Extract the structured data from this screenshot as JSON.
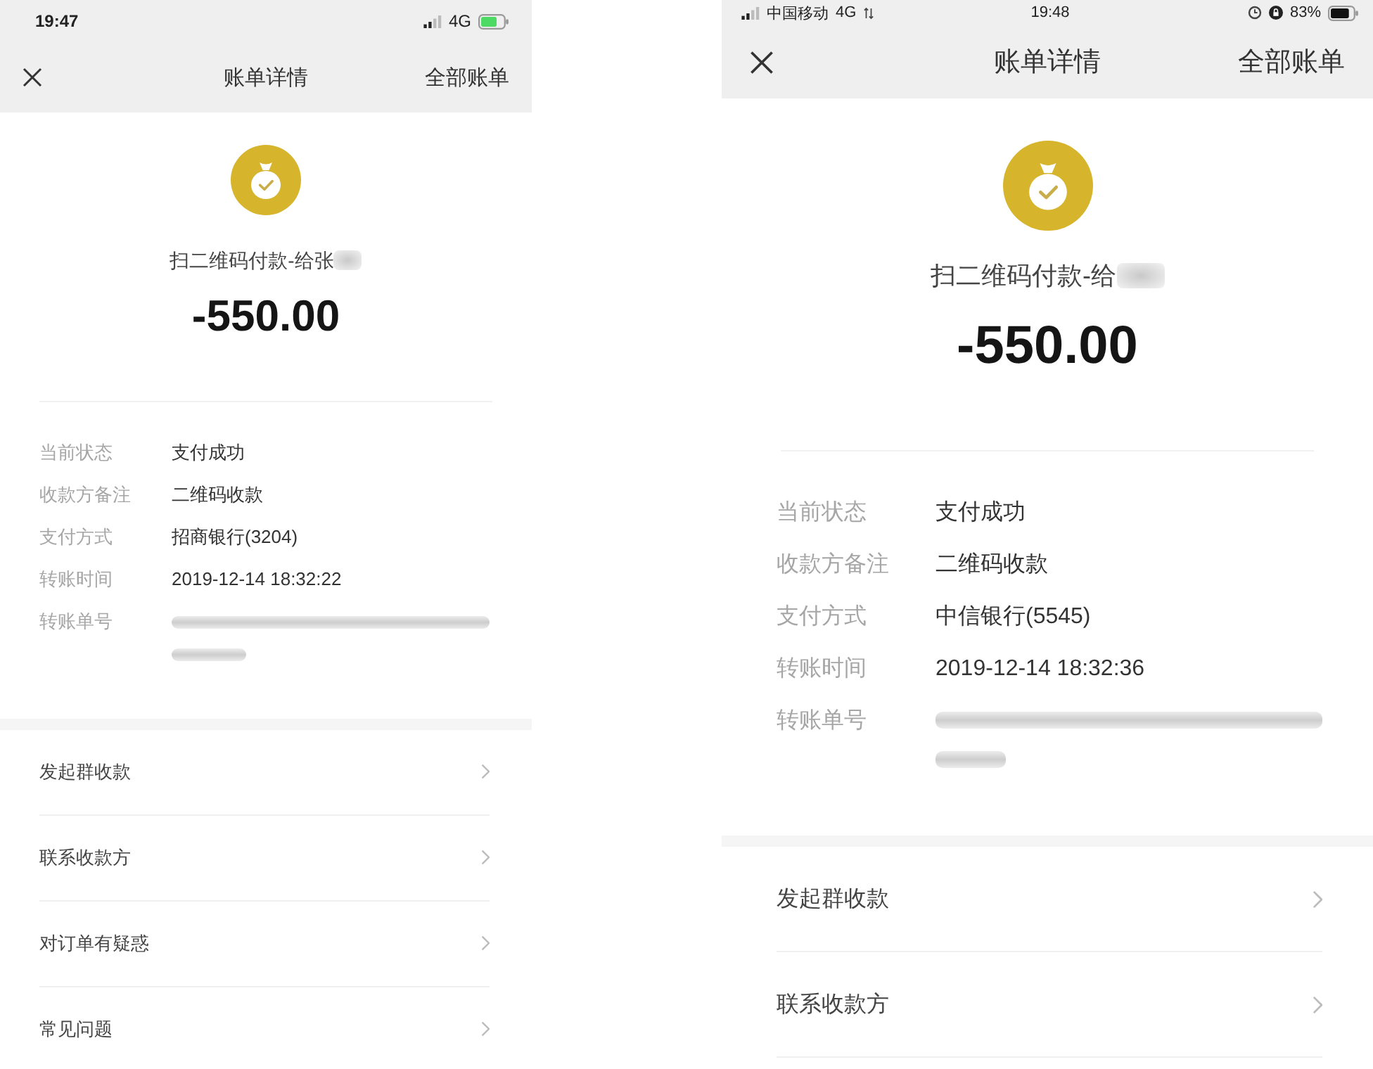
{
  "phones": [
    {
      "status_bar": {
        "kind": "compact",
        "time": "19:47",
        "network": "4G",
        "charging": true
      },
      "nav": {
        "title": "账单详情",
        "action": "全部账单"
      },
      "payment": {
        "title": "扫二维码付款-给张",
        "payee_blurred": true,
        "amount": "-550.00"
      },
      "details": [
        {
          "label": "当前状态",
          "value": "支付成功",
          "blurred": false
        },
        {
          "label": "收款方备注",
          "value": "二维码收款",
          "blurred": false
        },
        {
          "label": "支付方式",
          "value": "招商银行(3204)",
          "blurred": false
        },
        {
          "label": "转账时间",
          "value": "2019-12-14 18:32:22",
          "blurred": false
        },
        {
          "label": "转账单号",
          "blurred": true
        }
      ],
      "menu": [
        "发起群收款",
        "联系收款方",
        "对订单有疑惑",
        "常见问题"
      ]
    },
    {
      "status_bar": {
        "kind": "full",
        "carrier": "中国移动",
        "network": "4G",
        "time": "19:48",
        "battery_percent": "83%",
        "charging": false
      },
      "nav": {
        "title": "账单详情",
        "action": "全部账单"
      },
      "payment": {
        "title": "扫二维码付款-给",
        "payee_blurred": true,
        "amount": "-550.00"
      },
      "details": [
        {
          "label": "当前状态",
          "value": "支付成功",
          "blurred": false
        },
        {
          "label": "收款方备注",
          "value": "二维码收款",
          "blurred": false
        },
        {
          "label": "支付方式",
          "value": "中信银行(5545)",
          "blurred": false
        },
        {
          "label": "转账时间",
          "value": "2019-12-14 18:32:36",
          "blurred": false
        },
        {
          "label": "转账单号",
          "blurred": true
        }
      ],
      "menu": [
        "发起群收款",
        "联系收款方"
      ]
    }
  ]
}
